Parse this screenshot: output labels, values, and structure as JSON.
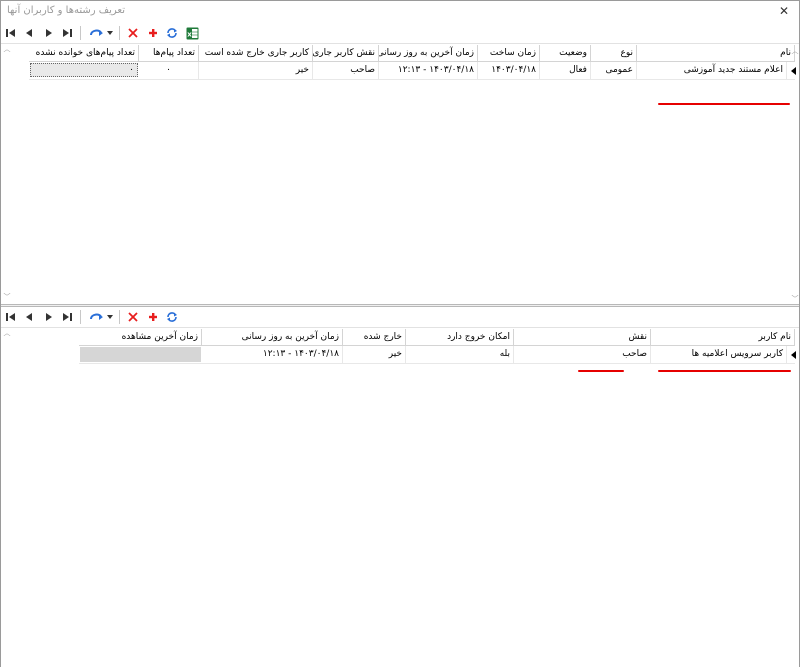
{
  "window": {
    "title": "تعریف رشته‌ها و کاربران آنها",
    "close_glyph": "✕"
  },
  "toolbar_icons": {
    "first": "first-record-icon",
    "prev": "previous-record-icon",
    "next": "next-record-icon",
    "last": "last-record-icon",
    "actions": "actions-dropdown-icon",
    "delete": "delete-icon",
    "add": "add-icon",
    "refresh": "refresh-icon",
    "excel": "excel-export-icon"
  },
  "colors": {
    "delete": "#e81e1e",
    "add": "#e81e1e",
    "refresh": "#2a6fd8",
    "excel": "#1f7a3a",
    "nav": "#333333",
    "underline": "#e60000"
  },
  "threads_grid": {
    "columns": {
      "name": "نام",
      "type": "نوع",
      "status": "وضعیت",
      "created": "زمان ساخت",
      "last_update": "زمان آخرین به روز رسانی",
      "user_role": "نقش کاربر جاری",
      "user_exited": "کاربر جاری خارج شده است",
      "message_count": "تعداد پیام‌ها",
      "unread_count": "تعداد پیام‌های خوانده نشده"
    },
    "rows": [
      {
        "name": "اعلام مستند جدید آموزشی",
        "type": "عمومی",
        "status": "فعال",
        "created": "۱۴۰۳/۰۴/۱۸",
        "last_update": "۱۴۰۳/۰۴/۱۸ - ۱۲:۱۳",
        "user_role": "صاحب",
        "user_exited": "خیر",
        "message_count": "۰",
        "unread_count": "۰"
      }
    ]
  },
  "users_grid": {
    "columns": {
      "user_name": "نام کاربر",
      "role": "نقش",
      "can_exit": "امکان خروج دارد",
      "exited": "خارج شده",
      "last_update": "زمان آخرین به روز رسانی",
      "last_seen": "زمان آخرین مشاهده"
    },
    "rows": [
      {
        "user_name": "کاربر سرویس اعلامیه ها",
        "role": "صاحب",
        "can_exit": "بله",
        "exited": "خیر",
        "last_update": "۱۴۰۳/۰۴/۱۸ - ۱۲:۱۳",
        "last_seen": ""
      }
    ]
  }
}
